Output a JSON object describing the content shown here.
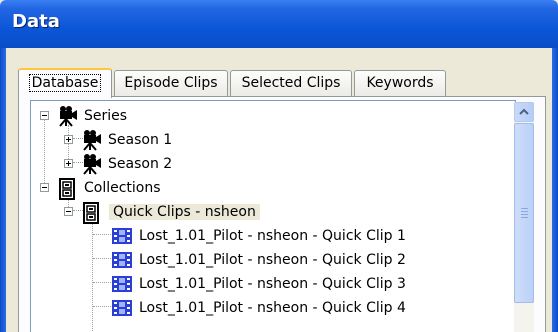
{
  "window": {
    "title": "Data"
  },
  "tabs": [
    {
      "label": "Database",
      "active": true
    },
    {
      "label": "Episode Clips",
      "active": false
    },
    {
      "label": "Selected Clips",
      "active": false
    },
    {
      "label": "Keywords",
      "active": false
    }
  ],
  "tree": {
    "series": {
      "label": "Series",
      "icon": "camera-icon",
      "children": [
        "Season 1",
        "Season 2"
      ]
    },
    "collections": {
      "label": "Collections",
      "icon": "filing-cabinet-icon",
      "selected": {
        "label": "Quick Clips - nsheon"
      },
      "clips": [
        "Lost_1.01_Pilot - nsheon - Quick Clip 1",
        "Lost_1.01_Pilot - nsheon - Quick Clip 2",
        "Lost_1.01_Pilot - nsheon - Quick Clip 3",
        "Lost_1.01_Pilot - nsheon - Quick Clip 4"
      ],
      "clip_icon": "film-clip-icon"
    }
  },
  "colors": {
    "titlebar": "#0b56d8",
    "active_tab_accent": "#ffc83c",
    "clip_icon": "#2b3fd6",
    "selection_bg": "#ece9d8"
  }
}
